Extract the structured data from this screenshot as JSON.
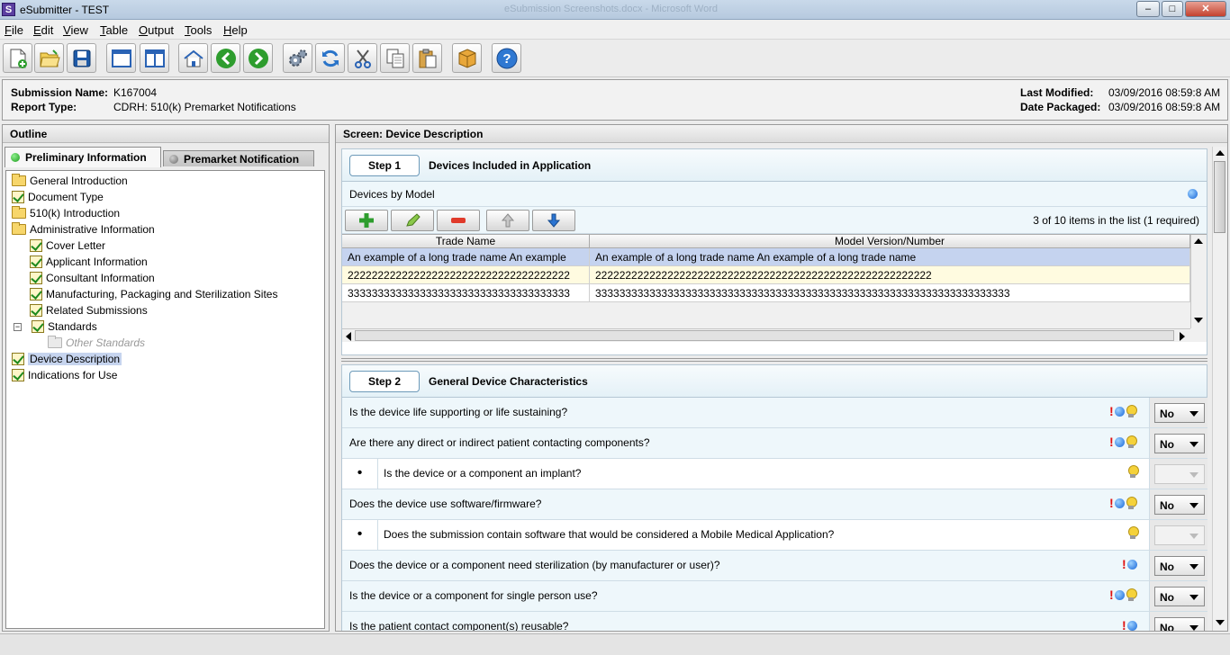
{
  "window": {
    "title": "eSubmitter - TEST",
    "app_icon": "S",
    "ghost_title": "eSubmission Screenshots.docx - Microsoft Word"
  },
  "menu": [
    "File",
    "Edit",
    "View",
    "Table",
    "Output",
    "Tools",
    "Help"
  ],
  "toolbar_icons": [
    "new-document-icon",
    "open-folder-icon",
    "save-icon",
    "window-icon",
    "split-view-icon",
    "home-icon",
    "back-arrow-icon",
    "forward-arrow-icon",
    "settings-icon",
    "refresh-icon",
    "cut-icon",
    "copy-icon",
    "paste-icon",
    "package-icon",
    "help-icon"
  ],
  "info": {
    "submission_name_label": "Submission Name:",
    "submission_name": "K167004",
    "report_type_label": "Report Type:",
    "report_type": "CDRH: 510(k) Premarket Notifications",
    "last_modified_label": "Last Modified:",
    "last_modified": "03/09/2016 08:59:8 AM",
    "date_packaged_label": "Date Packaged:",
    "date_packaged": "03/09/2016 08:59:8 AM"
  },
  "outline": {
    "title": "Outline",
    "tabs": [
      {
        "label": "Preliminary Information",
        "status_color": "#22b422"
      },
      {
        "label": "Premarket Notification",
        "status_color": "#8a8a8a"
      }
    ],
    "items": [
      {
        "label": "General Introduction",
        "icon": "folder-icon"
      },
      {
        "label": "Document Type",
        "icon": "check-icon"
      },
      {
        "label": "510(k) Introduction",
        "icon": "folder-icon"
      },
      {
        "label": "Administrative Information",
        "icon": "folder-icon"
      },
      {
        "label": "Cover Letter",
        "icon": "check-icon"
      },
      {
        "label": "Applicant Information",
        "icon": "check-icon"
      },
      {
        "label": "Consultant Information",
        "icon": "check-icon"
      },
      {
        "label": "Manufacturing, Packaging and Sterilization Sites",
        "icon": "check-icon"
      },
      {
        "label": "Related Submissions",
        "icon": "check-icon"
      },
      {
        "label": "Standards",
        "icon": "check-icon"
      },
      {
        "label": "Other Standards",
        "icon": "folder-icon"
      },
      {
        "label": "Device Description",
        "icon": "check-icon"
      },
      {
        "label": "Indications for Use",
        "icon": "check-icon"
      }
    ]
  },
  "screen": {
    "title": "Screen: Device Description",
    "step1": {
      "button": "Step 1",
      "title": "Devices Included in Application",
      "subheader": "Devices by Model",
      "count": "3 of 10 items in the list (1 required)",
      "columns": [
        "Trade Name",
        "Model Version/Number"
      ],
      "rows": [
        [
          "An example of a long trade name An example",
          "An example of a long trade name An example of a long trade name"
        ],
        [
          "2222222222222222222222222222222222222",
          "22222222222222222222222222222222222222222222222222222222"
        ],
        [
          "3333333333333333333333333333333333333",
          "333333333333333333333333333333333333333333333333333333333333333333333"
        ]
      ]
    },
    "step2": {
      "button": "Step 2",
      "title": "General Device Characteristics",
      "questions": [
        {
          "text": "Is the device life supporting or life sustaining?",
          "value": "No"
        },
        {
          "text": "Are there any direct or indirect patient contacting components?",
          "value": "No"
        },
        {
          "text": "Is the device or a component an implant?",
          "value": ""
        },
        {
          "text": "Does the device use software/firmware?",
          "value": "No"
        },
        {
          "text": "Does the submission contain software that would be considered a Mobile Medical Application?",
          "value": ""
        },
        {
          "text": "Does the device or a component need sterilization (by manufacturer or user)?",
          "value": "No"
        },
        {
          "text": "Is the device or a component for single person use?",
          "value": "No"
        },
        {
          "text": "Is the patient contact component(s) reusable?",
          "value": "No"
        }
      ],
      "bullet": "•",
      "required_mark": "!"
    }
  }
}
